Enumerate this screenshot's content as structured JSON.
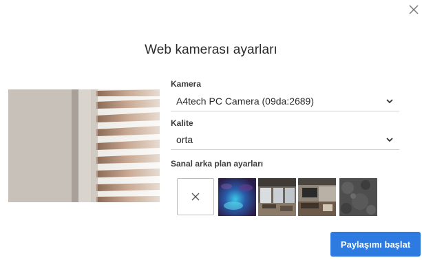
{
  "dialog": {
    "title": "Web kamerası ayarları",
    "close_icon": "close-icon"
  },
  "camera": {
    "label": "Kamera",
    "value": "A4tech PC Camera (09da:2689)"
  },
  "quality": {
    "label": "Kalite",
    "value": "orta"
  },
  "virtual_background": {
    "label": "Sanal arka plan ayarları",
    "options": [
      {
        "name": "none",
        "icon": "close-icon"
      },
      {
        "name": "blue-abstract"
      },
      {
        "name": "office-room"
      },
      {
        "name": "living-room"
      },
      {
        "name": "gray-texture"
      }
    ]
  },
  "footer": {
    "start_label": "Paylaşımı başlat"
  },
  "colors": {
    "accent": "#2d7be0"
  }
}
